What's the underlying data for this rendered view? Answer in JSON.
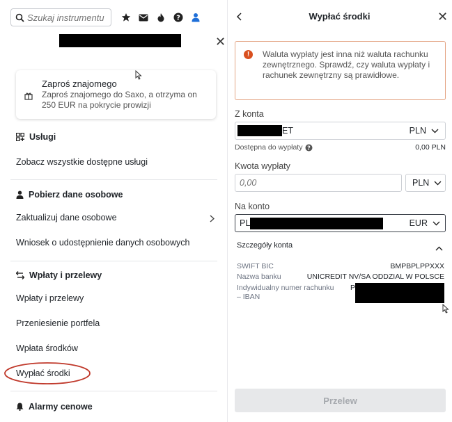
{
  "left_panel": {
    "search": {
      "placeholder": "Szukaj instrumentu"
    },
    "icons": [
      "search-icon",
      "star-icon",
      "mail-icon",
      "theme-icon",
      "help-icon",
      "user-icon"
    ],
    "invite": {
      "title": "Zaproś znajomego",
      "description": "Zaproś znajomego do Saxo, a otrzyma on 250 EUR na pokrycie prowizji"
    },
    "sections": {
      "services": {
        "heading": "Usługi",
        "items": [
          "Zobacz wszystkie dostępne usługi"
        ]
      },
      "personal_data": {
        "heading": "Pobierz dane osobowe",
        "items": [
          "Zaktualizuj dane osobowe",
          "Wniosek o udostępnienie danych osobowych"
        ]
      },
      "transfers": {
        "heading": "Wpłaty i przelewy",
        "items": [
          "Wpłaty i przelewy",
          "Przeniesienie portfela",
          "Wpłata środków",
          "Wypłać środki"
        ]
      },
      "alerts": {
        "heading": "Alarmy cenowe"
      }
    }
  },
  "right_panel": {
    "title": "Wypłać środki",
    "warning": "Waluta wypłaty jest inna niż waluta rachunku zewnętrznego. Sprawdź, czy waluta wypłaty i rachunek zewnętrzny są prawidłowe.",
    "from_account": {
      "label": "Z konta",
      "value_suffix": "ET",
      "currency": "PLN",
      "available_label": "Dostępna do wypłaty",
      "available_value": "0,00 PLN"
    },
    "amount": {
      "label": "Kwota wypłaty",
      "placeholder": "0,00",
      "currency": "PLN"
    },
    "to_account": {
      "label": "Na konto",
      "value_prefix": "PL",
      "currency": "EUR"
    },
    "details": {
      "heading": "Szczegóły konta",
      "swift_label": "SWIFT BIC",
      "swift_value": "BMPBPLPPXXX",
      "bank_label": "Nazwa banku",
      "bank_value": "UNICREDIT NV/SA ODDZIAL W POLSCE",
      "iban_label": "Indywidualny numer rachunku – IBAN",
      "iban_prefix": "P"
    },
    "submit_label": "Przelew"
  },
  "colors": {
    "accent_blue": "#1f6fd8",
    "warning_orange": "#d9501f",
    "highlight_circle": "#c0392b"
  }
}
